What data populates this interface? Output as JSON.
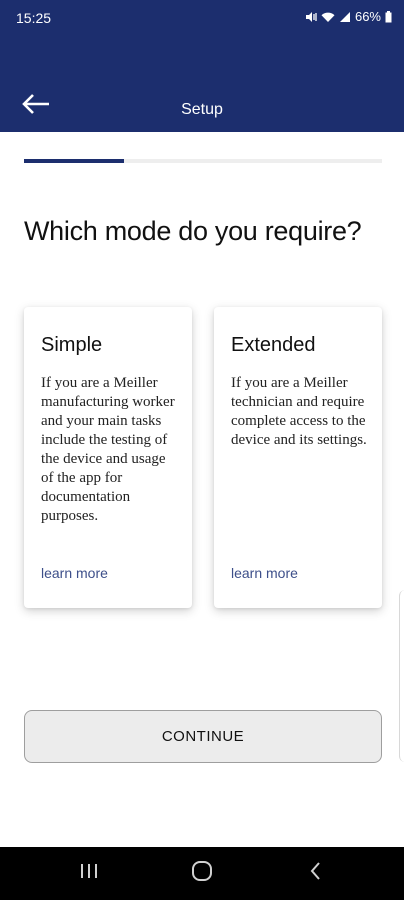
{
  "status_bar": {
    "time": "15:25",
    "battery": "66%"
  },
  "app_bar": {
    "title": "Setup"
  },
  "progress": {
    "fraction": 0.28
  },
  "question": "Which mode do you require?",
  "options": [
    {
      "title": "Simple",
      "description": "If you are a Meiller manufacturing worker and your main tasks include the testing of the device and usage of the app for documentation purposes.",
      "link": "learn more"
    },
    {
      "title": "Extended",
      "description": "If you are a Meiller technician and require complete access to the device and its settings.",
      "link": "learn more"
    }
  ],
  "continue_label": "CONTINUE",
  "colors": {
    "brand": "#1c2e6e",
    "link": "#3d4f8a",
    "button_bg": "#ececec"
  },
  "icons": {
    "back": "arrow-left-icon",
    "recents": "recents-icon",
    "home": "home-icon",
    "nav_back": "chevron-left-icon"
  }
}
